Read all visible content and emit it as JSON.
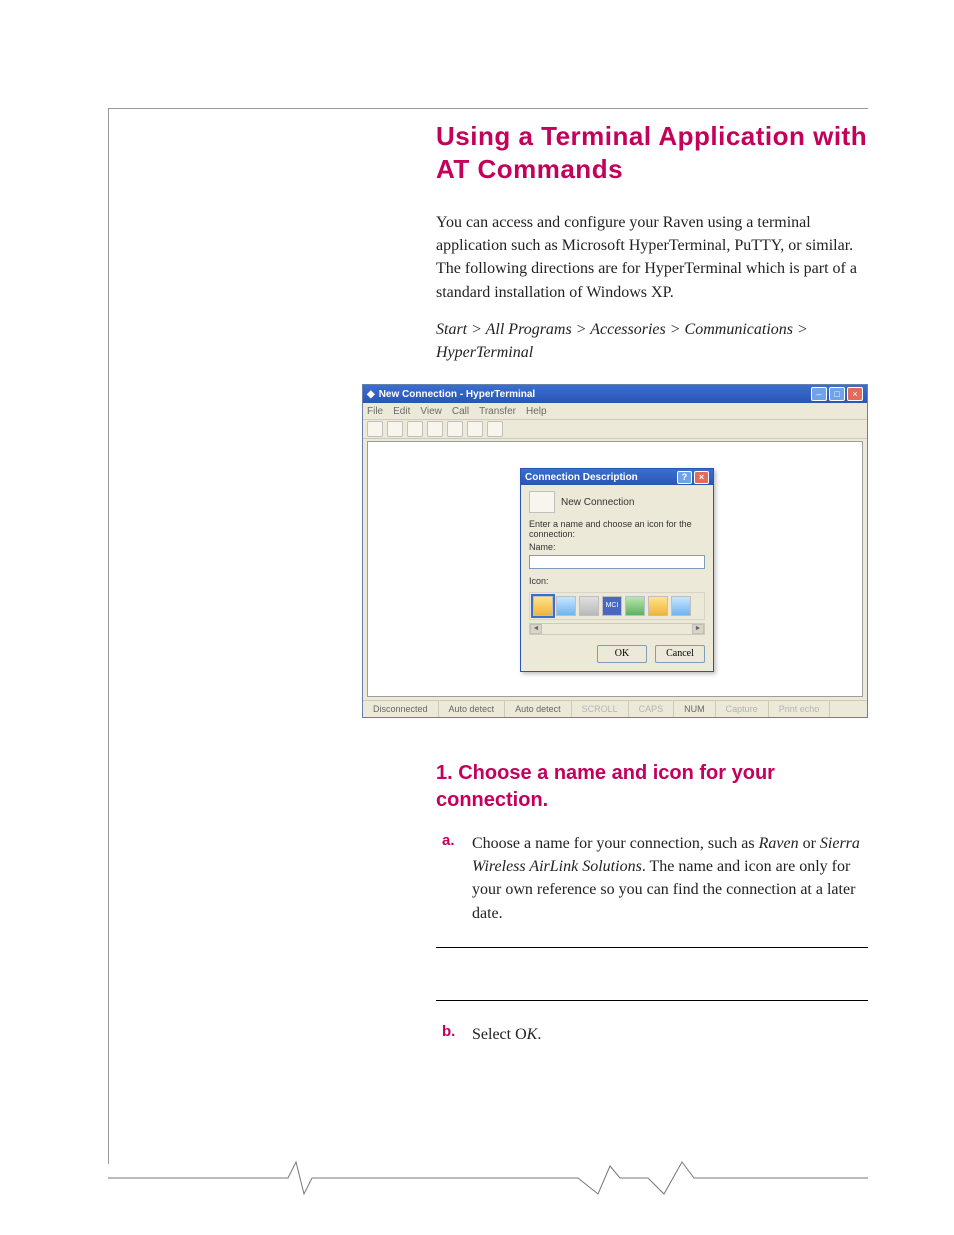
{
  "heading": "Using a Terminal Application with AT Commands",
  "intro": "You can access and configure your Raven using a terminal application such as Microsoft HyperTerminal, PuTTY, or similar. The following directions are for HyperTerminal which is part of a standard installation of Windows XP.",
  "path": "Start > All Programs > Accessories > Communications > HyperTerminal",
  "figure": {
    "title": "New Connection - HyperTerminal",
    "menu": [
      "File",
      "Edit",
      "View",
      "Call",
      "Transfer",
      "Help"
    ],
    "dialog": {
      "title": "Connection Description",
      "subtitle": "New Connection",
      "prompt": "Enter a name and choose an icon for the connection:",
      "name_label": "Name:",
      "icon_label": "Icon:",
      "ok": "OK",
      "cancel": "Cancel",
      "mci": "MCI"
    },
    "status": {
      "conn": "Disconnected",
      "d1": "Auto detect",
      "d2": "Auto detect",
      "scroll": "SCROLL",
      "caps": "CAPS",
      "num": "NUM",
      "capture": "Capture",
      "echo": "Print echo"
    }
  },
  "section": {
    "title": "1. Choose a name and icon for your connection.",
    "a": {
      "label": "a.",
      "pre": "Choose a name for your connection, such as ",
      "em1": "Raven",
      "mid": " or ",
      "em2": "Sierra Wireless AirLink Solutions",
      "post": ". The name and icon are only for your own reference so you can find the connection at a later date."
    },
    "b": {
      "label": "b.",
      "pre": "Select O",
      "em": "K",
      "post": "."
    }
  }
}
